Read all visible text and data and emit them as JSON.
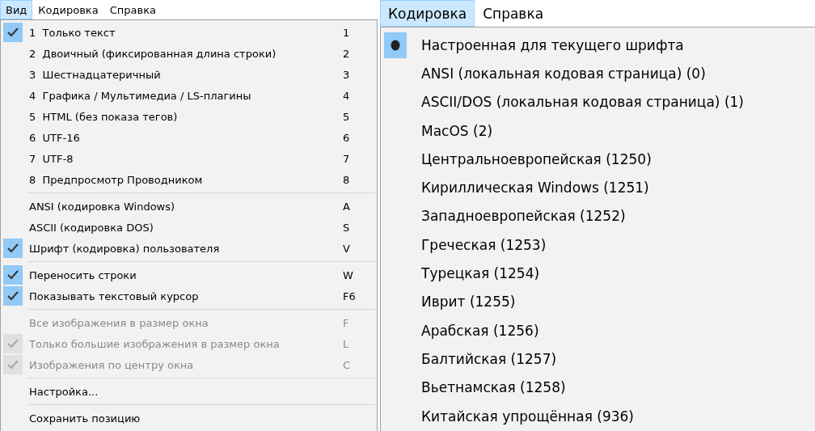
{
  "panels": [
    {
      "menubar": [
        {
          "label": "Вид",
          "selected": true
        },
        {
          "label": "Кодировка",
          "selected": false
        },
        {
          "label": "Справка",
          "selected": false
        }
      ],
      "menu": [
        {
          "kind": "item",
          "label": "1  Только текст",
          "shortcut": "1",
          "checked": true,
          "disabled": false
        },
        {
          "kind": "item",
          "label": "2  Двоичный (фиксированная длина строки)",
          "shortcut": "2",
          "checked": false,
          "disabled": false
        },
        {
          "kind": "item",
          "label": "3  Шестнадцатеричный",
          "shortcut": "3",
          "checked": false,
          "disabled": false
        },
        {
          "kind": "item",
          "label": "4  Графика / Мультимедиа / LS-плагины",
          "shortcut": "4",
          "checked": false,
          "disabled": false
        },
        {
          "kind": "item",
          "label": "5  HTML (без показа тегов)",
          "shortcut": "5",
          "checked": false,
          "disabled": false
        },
        {
          "kind": "item",
          "label": "6  UTF-16",
          "shortcut": "6",
          "checked": false,
          "disabled": false
        },
        {
          "kind": "item",
          "label": "7  UTF-8",
          "shortcut": "7",
          "checked": false,
          "disabled": false
        },
        {
          "kind": "item",
          "label": "8  Предпросмотр Проводником",
          "shortcut": "8",
          "checked": false,
          "disabled": false
        },
        {
          "kind": "separator"
        },
        {
          "kind": "item",
          "label": "ANSI (кодировка Windows)",
          "shortcut": "A",
          "checked": false,
          "disabled": false
        },
        {
          "kind": "item",
          "label": "ASCII (кодировка DOS)",
          "shortcut": "S",
          "checked": false,
          "disabled": false
        },
        {
          "kind": "item",
          "label": "Шрифт (кодировка) пользователя",
          "shortcut": "V",
          "checked": true,
          "disabled": false
        },
        {
          "kind": "separator"
        },
        {
          "kind": "item",
          "label": "Переносить строки",
          "shortcut": "W",
          "checked": true,
          "disabled": false
        },
        {
          "kind": "item",
          "label": "Показывать текстовый курсор",
          "shortcut": "F6",
          "checked": true,
          "disabled": false
        },
        {
          "kind": "separator"
        },
        {
          "kind": "item",
          "label": "Все изображения в размер окна",
          "shortcut": "F",
          "checked": false,
          "disabled": true
        },
        {
          "kind": "item",
          "label": "Только большие изображения в размер окна",
          "shortcut": "L",
          "checked": true,
          "disabled": true
        },
        {
          "kind": "item",
          "label": "Изображения по центру окна",
          "shortcut": "C",
          "checked": true,
          "disabled": true
        },
        {
          "kind": "separator"
        },
        {
          "kind": "item",
          "label": "Настройка...",
          "checked": false,
          "disabled": false
        },
        {
          "kind": "separator"
        },
        {
          "kind": "item",
          "label": "Сохранить позицию",
          "checked": false,
          "disabled": false
        }
      ]
    },
    {
      "menubar": [
        {
          "label": "Кодировка",
          "selected": true
        },
        {
          "label": "Справка",
          "selected": false
        }
      ],
      "menu": [
        {
          "kind": "radio",
          "label": "Настроенная для текущего шрифта",
          "selected": true
        },
        {
          "kind": "radio",
          "label": "ANSI (локальная кодовая страница) (0)",
          "selected": false
        },
        {
          "kind": "radio",
          "label": "ASCII/DOS (локальная кодовая страница) (1)",
          "selected": false
        },
        {
          "kind": "radio",
          "label": "MacOS (2)",
          "selected": false
        },
        {
          "kind": "radio",
          "label": "Центральноевропейская (1250)",
          "selected": false
        },
        {
          "kind": "radio",
          "label": "Кириллическая Windows (1251)",
          "selected": false
        },
        {
          "kind": "radio",
          "label": "Западноевропейская (1252)",
          "selected": false
        },
        {
          "kind": "radio",
          "label": "Греческая (1253)",
          "selected": false
        },
        {
          "kind": "radio",
          "label": "Турецкая (1254)",
          "selected": false
        },
        {
          "kind": "radio",
          "label": "Иврит (1255)",
          "selected": false
        },
        {
          "kind": "radio",
          "label": "Арабская (1256)",
          "selected": false
        },
        {
          "kind": "radio",
          "label": "Балтийская (1257)",
          "selected": false
        },
        {
          "kind": "radio",
          "label": "Вьетнамская (1258)",
          "selected": false
        },
        {
          "kind": "radio",
          "label": "Китайская упрощённая (936)",
          "selected": false
        }
      ]
    }
  ]
}
